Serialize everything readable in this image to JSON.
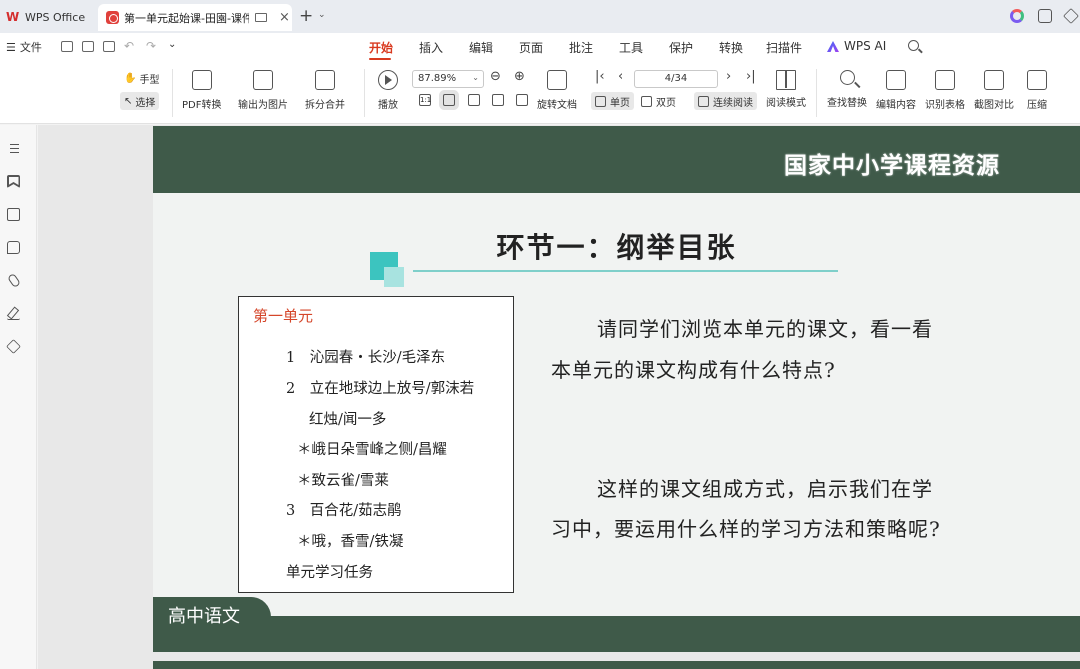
{
  "app": {
    "name": "WPS Office",
    "doc_tab_title": "第一单元起始课-田園-课件.p",
    "tab_close": "×",
    "tab_add": "+",
    "tab_dropdown": "⌄"
  },
  "menubar": {
    "hamburger": "☰",
    "file_label": "文件",
    "tabs": [
      "开始",
      "插入",
      "编辑",
      "页面",
      "批注",
      "工具",
      "保护",
      "转换",
      "扫描件",
      "WPS AI"
    ],
    "active_tab": "开始"
  },
  "ribbon": {
    "hand_tool": "手型",
    "select_tool": "选择",
    "pdf_convert": "PDF转换",
    "export_image": "输出为图片",
    "split_merge": "拆分合并",
    "play": "播放",
    "zoom": "87.89%",
    "page": "4/34",
    "rotate": "旋转文档",
    "single_page": "单页",
    "double_page": "双页",
    "continuous": "连续阅读",
    "reading_mode": "阅读模式",
    "find_replace": "查找替换",
    "edit_content": "编辑内容",
    "recognize_table": "识别表格",
    "screenshot_compare": "截图对比",
    "compress": "压缩",
    "fit_label": "1:1"
  },
  "slide": {
    "brand": "国家中小学课程资源",
    "title": "环节一：纲举目张",
    "toc": {
      "heading": "第一单元",
      "items": [
        "1　沁园春・长沙/毛泽东",
        "2　立在地球边上放号/郭沫若",
        "红烛/闻一多",
        "＊峨日朵雪峰之侧/昌耀",
        "＊致云雀/雪莱",
        "3　百合花/茹志鹃",
        "＊哦，香雪/铁凝",
        "单元学习任务"
      ]
    },
    "paragraph1_line1": "请同学们浏览本单元的课文，看一看",
    "paragraph1_line2": "本单元的课文构成有什么特点?",
    "paragraph2_line1": "这样的课文组成方式，启示我们在学",
    "paragraph2_line2": "习中，要运用什么样的学习方法和策略呢?",
    "footer_label": "高中语文"
  }
}
